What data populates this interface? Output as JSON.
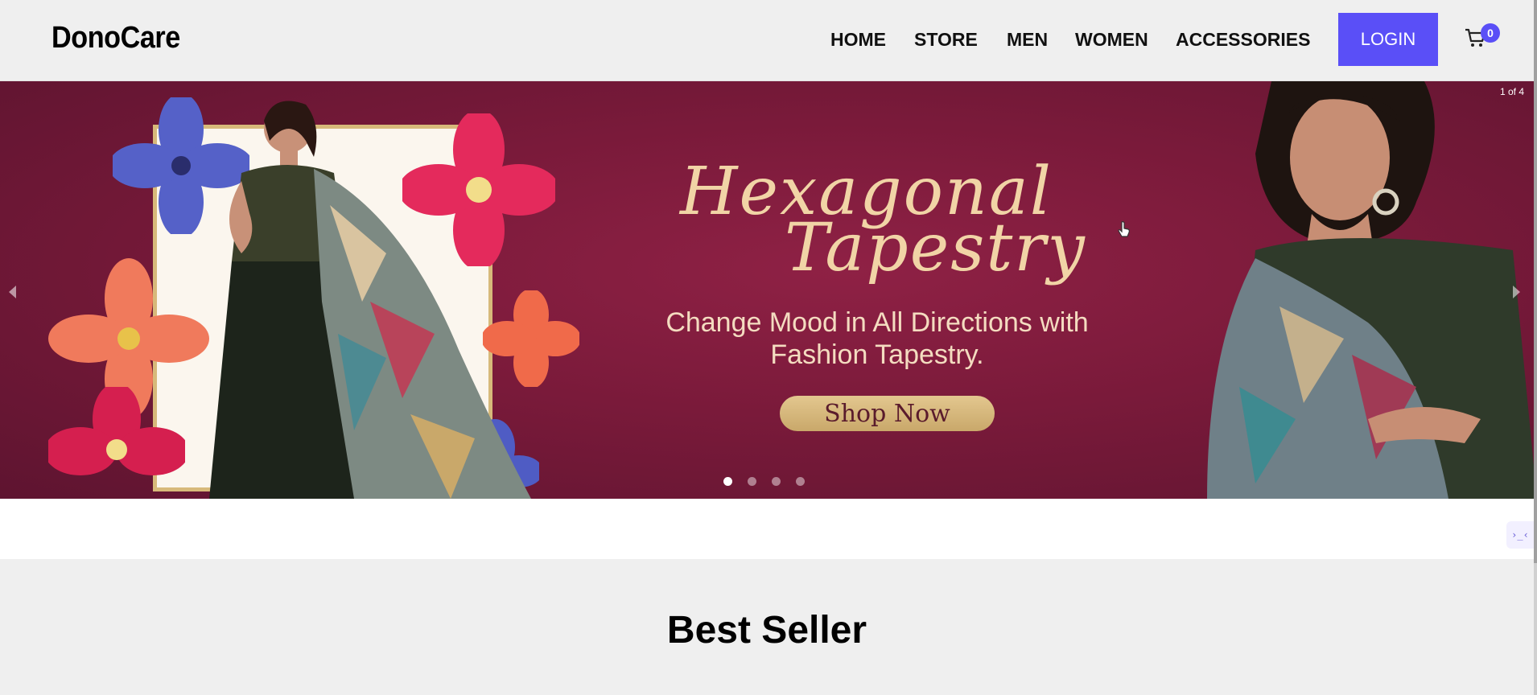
{
  "brand": {
    "name": "DonoCare"
  },
  "nav": {
    "items": [
      {
        "label": "HOME"
      },
      {
        "label": "STORE"
      },
      {
        "label": "MEN"
      },
      {
        "label": "WOMEN"
      },
      {
        "label": "ACCESSORIES"
      }
    ],
    "login_label": "LOGIN",
    "cart_count": "0"
  },
  "hero": {
    "slide_counter": "1 of 4",
    "headline_line1": "Hexagonal",
    "headline_line2": "Tapestry",
    "tagline_line1": "Change Mood in All Directions with",
    "tagline_line2": "Fashion Tapestry.",
    "cta_label": "Shop Now",
    "total_slides": 4,
    "active_slide": 1
  },
  "section": {
    "title": "Best Seller"
  },
  "colors": {
    "accent": "#5a4ff7",
    "hero_bg": "#7a1a3a",
    "headline": "#f1d4a6"
  },
  "icons": [
    "cart-icon",
    "chevron-left-icon",
    "chevron-right-icon",
    "pointer-cursor-icon",
    "widget-icon"
  ]
}
